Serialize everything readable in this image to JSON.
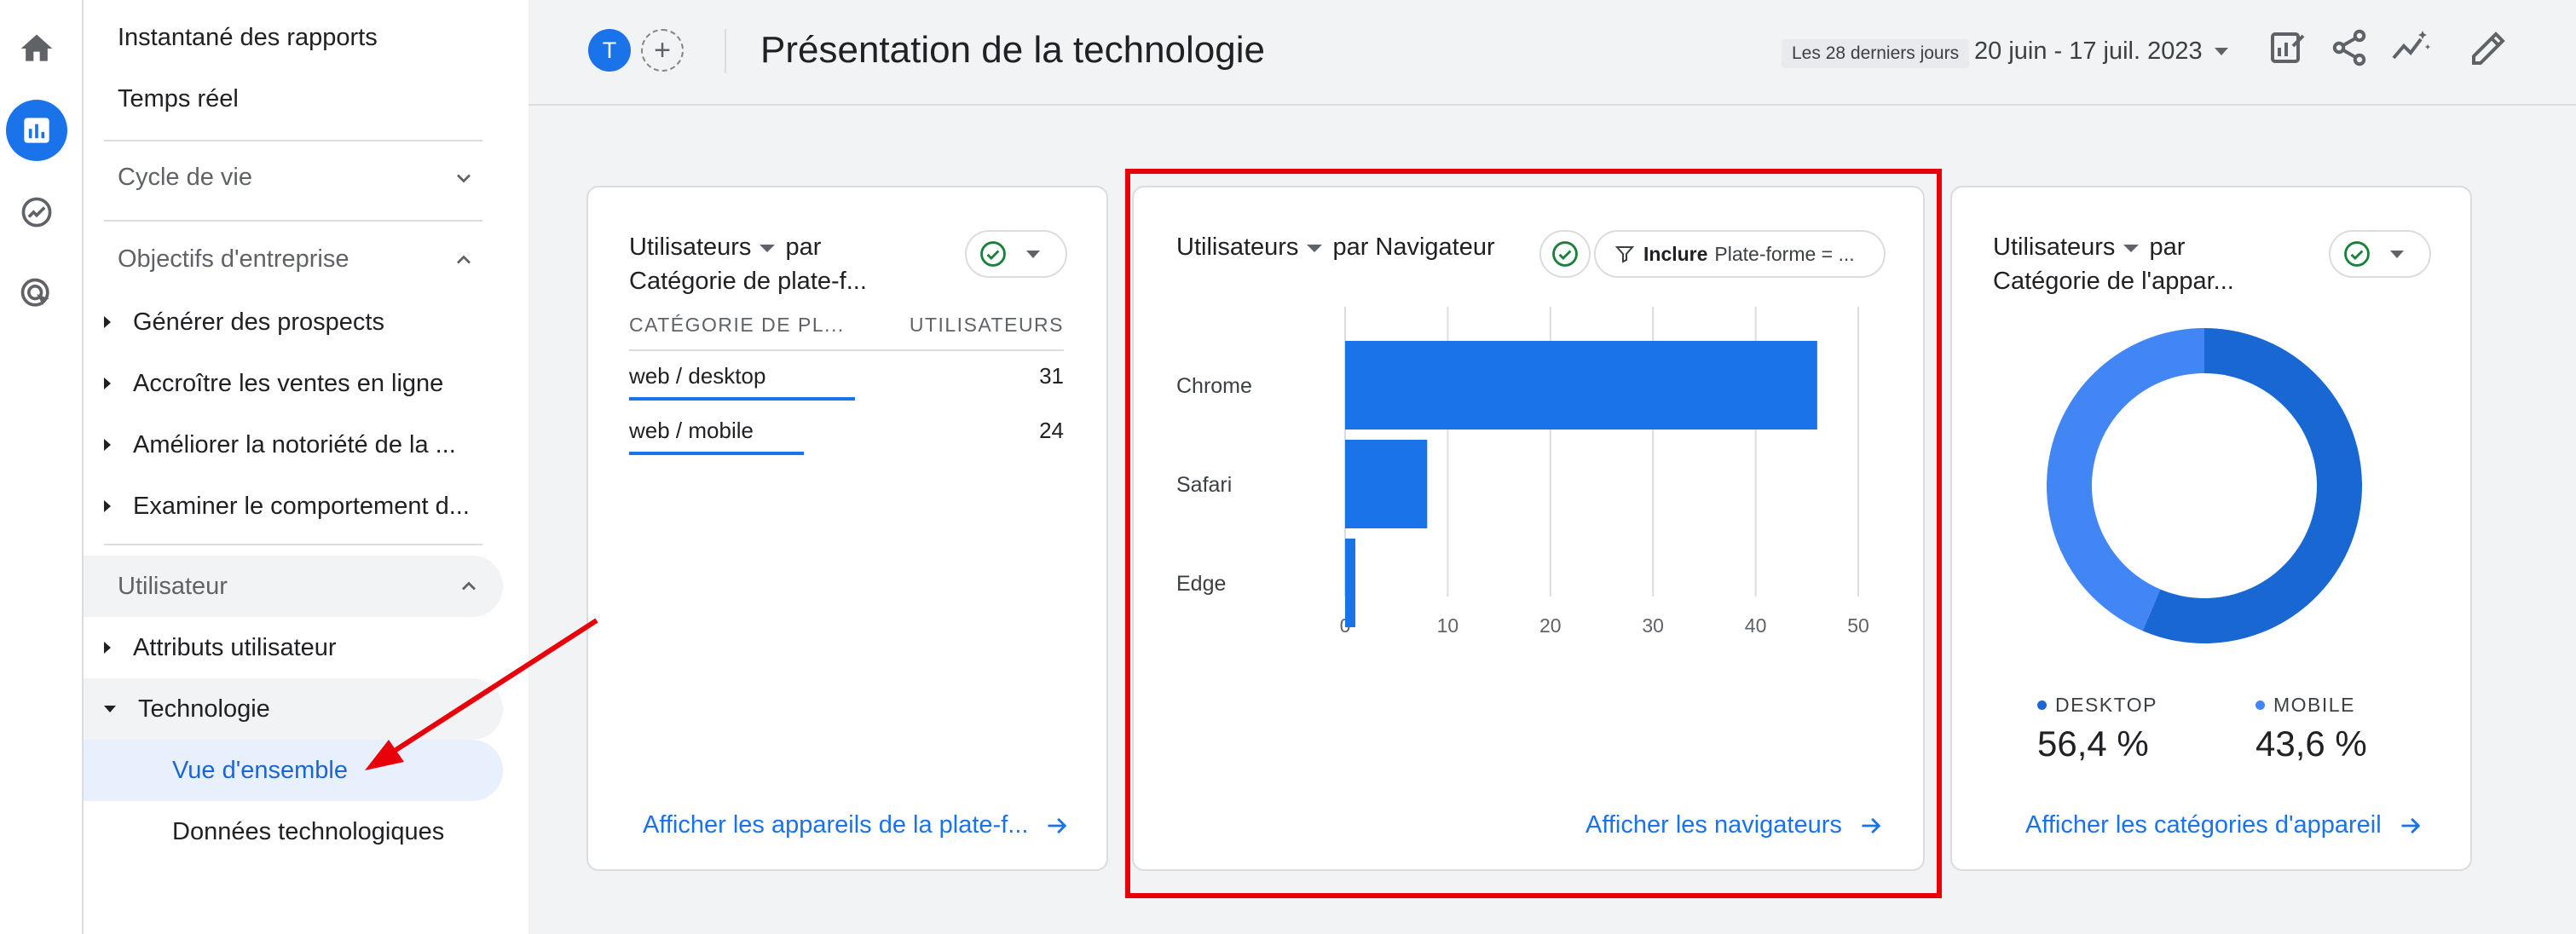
{
  "nav": {
    "items_top": [
      "Instantané des rapports",
      "Temps réel"
    ],
    "lifecycle": "Cycle de vie",
    "business": "Objectifs d'entreprise",
    "business_items": [
      "Générer des prospects",
      "Accroître les ventes en ligne",
      "Améliorer la notoriété de la ...",
      "Examiner le comportement d..."
    ],
    "user_section": "Utilisateur",
    "user_attributes": "Attributs utilisateur",
    "technology": "Technologie",
    "overview": "Vue d'ensemble",
    "tech_data": "Données technologiques"
  },
  "header": {
    "avatar_letter": "T",
    "title": "Présentation de la technologie",
    "date_chip": "Les 28 derniers jours",
    "date_range": "20 juin - 17 juil. 2023"
  },
  "cards": {
    "platform": {
      "title_metric": "Utilisateurs",
      "title_rest": "par",
      "title_line2": "Catégorie de plate-f...",
      "col1": "CATÉGORIE DE PL...",
      "col2": "UTILISATEURS",
      "rows": [
        {
          "label": "web / desktop",
          "value": "31",
          "share": 0.5636
        },
        {
          "label": "web / mobile",
          "value": "24",
          "share": 0.4364
        }
      ],
      "link": "Afficher les appareils de la plate-f..."
    },
    "browser": {
      "title_metric": "Utilisateurs",
      "title_rest": "par Navigateur",
      "filter_bold": "Inclure",
      "filter_text": "Plate-forme = ...",
      "link": "Afficher les navigateurs"
    },
    "device": {
      "title_metric": "Utilisateurs",
      "title_rest": "par",
      "title_line2": "Catégorie de l'appar...",
      "legend": [
        {
          "label": "DESKTOP",
          "value": "56,4 %",
          "color": "#1967d2"
        },
        {
          "label": "MOBILE",
          "value": "43,6 %",
          "color": "#4285f4"
        }
      ],
      "link": "Afficher les catégories d'appareil"
    }
  },
  "chart_data": [
    {
      "type": "bar",
      "orientation": "horizontal",
      "categories": [
        "Chrome",
        "Safari",
        "Edge"
      ],
      "values": [
        46,
        8,
        1
      ],
      "xlim": [
        0,
        50
      ],
      "xticks": [
        0,
        10,
        20,
        30,
        40,
        50
      ],
      "grid": true,
      "color": "#1a73e8"
    },
    {
      "type": "pie",
      "donut": true,
      "categories": [
        "DESKTOP",
        "MOBILE"
      ],
      "values": [
        56.4,
        43.6
      ],
      "colors": [
        "#1967d2",
        "#4285f4"
      ]
    }
  ],
  "colors": {
    "accent": "#1a73e8",
    "highlight_box": "#e8000b",
    "annotation_arrow": "#e8000b"
  }
}
